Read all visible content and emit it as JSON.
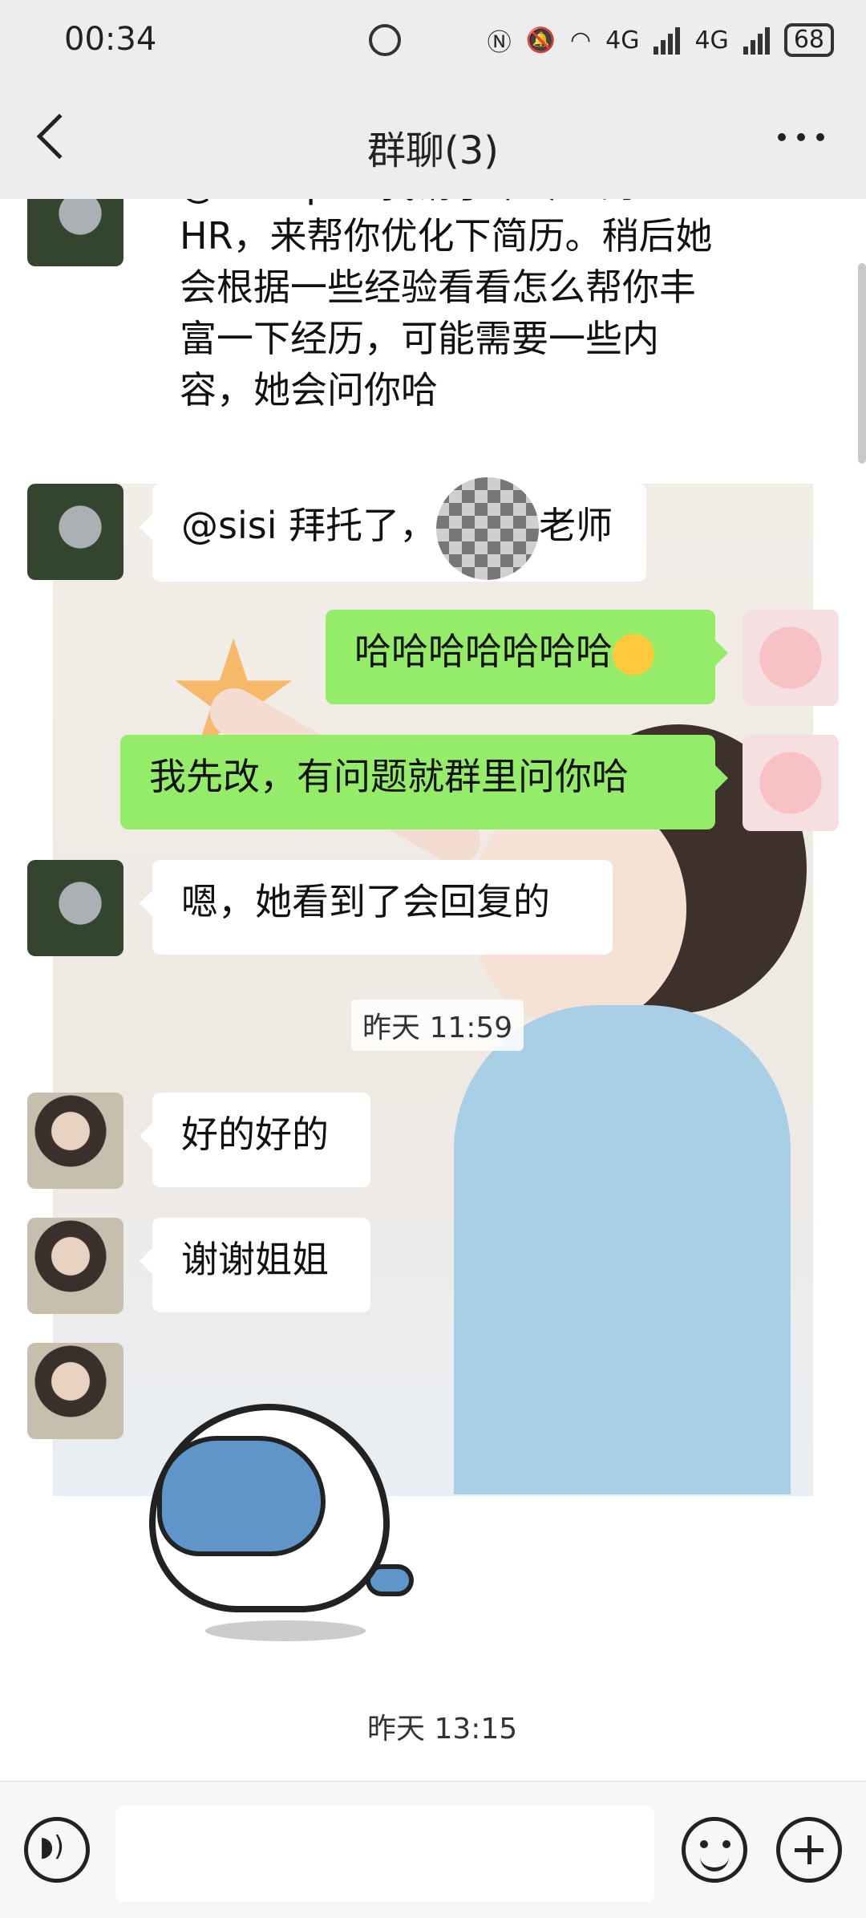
{
  "status_bar": {
    "time": "00:34",
    "network_1": "4G",
    "network_2": "4G",
    "battery": "68"
  },
  "header": {
    "title": "群聊(3)"
  },
  "messages": [
    {
      "id": "m1",
      "side": "left",
      "avatar": "donkey",
      "text": "@Whisper 我请了个专业的HR，来帮你优化下简历。稍后她会根据一些经验看看怎么帮你丰富一下经历，可能需要一些内容，她会问你哈"
    },
    {
      "id": "m2",
      "side": "left",
      "avatar": "donkey",
      "text_prefix": "@sisi  拜托了，",
      "text_suffix": "老师"
    },
    {
      "id": "m3",
      "side": "right",
      "avatar": "pink",
      "text": "哈哈哈哈哈哈哈"
    },
    {
      "id": "m4",
      "side": "right",
      "avatar": "pink",
      "text": "我先改，有问题就群里问你哈"
    },
    {
      "id": "m5",
      "side": "left",
      "avatar": "donkey",
      "text": "嗯，她看到了会回复的"
    },
    {
      "id": "m6",
      "side": "left",
      "avatar": "girl",
      "text": "好的好的"
    },
    {
      "id": "m7",
      "side": "left",
      "avatar": "girl",
      "text": "谢谢姐姐"
    },
    {
      "id": "m8",
      "side": "left",
      "avatar": "girl",
      "type": "sticker"
    }
  ],
  "timestamps": {
    "t1": "昨天 11:59",
    "t2": "昨天 13:15"
  },
  "colors": {
    "header_bg": "#ededed",
    "self_bubble": "#95ec69",
    "other_bubble": "#ffffff"
  }
}
